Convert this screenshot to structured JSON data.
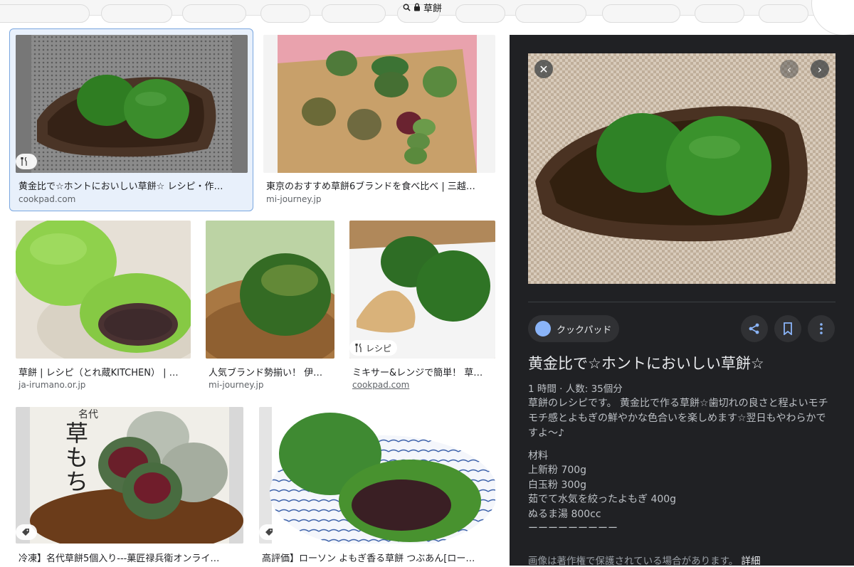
{
  "browser": {
    "address_text": "草餅"
  },
  "results": [
    {
      "caption": "黄金比で☆ホントにおいしい草餅☆ レシピ・作…",
      "source": "cookpad.com",
      "badge": ""
    },
    {
      "caption": "東京のおすすめ草餅6ブランドを食べ比べ | 三越…",
      "source": "mi-journey.jp",
      "badge": ""
    },
    {
      "caption": "草餅 | レシピ（とれ蔵KITCHEN） | …",
      "source": "ja-irumano.or.jp",
      "badge": ""
    },
    {
      "caption": "人気ブランド勢揃い！ 伊…",
      "source": "mi-journey.jp",
      "badge": ""
    },
    {
      "caption": "ミキサー&レンジで簡単！ 草…",
      "source": "cookpad.com",
      "badge": "レシピ"
    },
    {
      "caption": "冷凍】名代草餅5個入り---菓匠禄兵衛オンライ…",
      "source": "",
      "badge": ""
    },
    {
      "caption": "高評価】ローソン よもぎ香る草餅 つぶあん[ロー…",
      "source": "",
      "badge": ""
    }
  ],
  "thumb_text": {
    "kusamochi_brand": "名代",
    "kusamochi_big": "草もち"
  },
  "detail": {
    "site_name": "クックパッド",
    "title": "黄金比で☆ホントにおいしい草餅☆",
    "meta": "1 時間 · 人数: 35個分",
    "description": "草餅のレシピです。 黄金比で作る草餅☆歯切れの良さと程よいモチモチ感とよもぎの鮮やかな色合いを楽しめます☆翌日もやわらかですよ〜♪",
    "ingredients_heading": "材料",
    "ingredients": [
      "上新粉 700g",
      "白玉粉 300g",
      "茹でて水気を絞ったよもぎ 400g",
      "ぬるま湯 800cc",
      "ーーーーーーーーー"
    ],
    "copyright_note": "画像は著作権で保護されている場合があります。",
    "details_link": "詳細"
  },
  "colors": {
    "panel_bg": "#202124",
    "selected_border": "#7aa7e0",
    "mochi_green": "#3f8a2e"
  }
}
